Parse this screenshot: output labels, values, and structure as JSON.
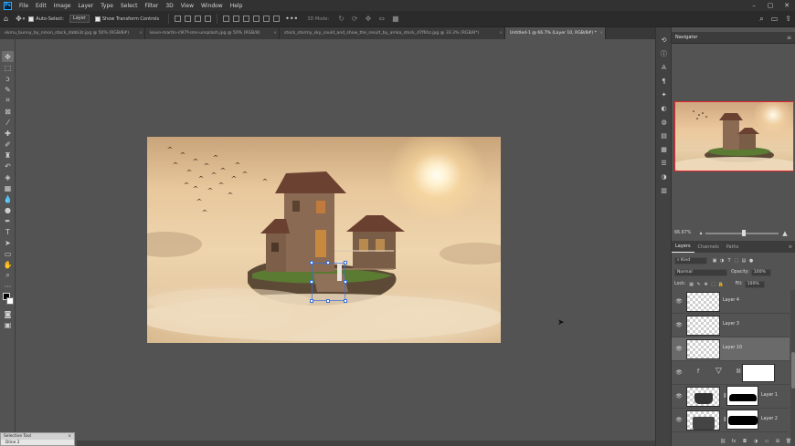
{
  "app": {
    "logo": "Ps"
  },
  "menu": [
    "File",
    "Edit",
    "Image",
    "Layer",
    "Type",
    "Select",
    "Filter",
    "3D",
    "View",
    "Window",
    "Help"
  ],
  "window_controls": [
    "minimize-icon",
    "maximize-icon",
    "close-icon"
  ],
  "options": {
    "auto_select_label": "Auto-Select:",
    "auto_select_value": "Layer",
    "transform_label": "Show Transform Controls",
    "mode_label": "3D Mode:",
    "more": "•••"
  },
  "tabs": [
    {
      "label": "ekmu_bunny_by_nmon_stock_dabb3z.jpg @ 50% (RGB/8#)",
      "active": false
    },
    {
      "label": "kevin-martin-c9l7f-sms-unsplash.jpg @ 50% (RGB/8)",
      "active": false
    },
    {
      "label": "stock_stormy_sky_could_and_show_the_result_by_amka_stock_d7f6hz.jpg @ 33.3% (RGB/8*)",
      "active": false
    },
    {
      "label": "Untitled-1 @ 66.7% (Layer 10, RGB/8#) *",
      "active": true
    }
  ],
  "navigator": {
    "title": "Navigator",
    "zoom": "66.67%"
  },
  "layers_panel": {
    "tabs": [
      "Layers",
      "Channels",
      "Paths"
    ],
    "kind_label": "Kind",
    "blend_mode": "Normal",
    "opacity_label": "Opacity:",
    "opacity_value": "100%",
    "lock_label": "Lock:",
    "fill_label": "Fill:",
    "fill_value": "100%",
    "layers": [
      {
        "name": "Layer 4",
        "selected": false
      },
      {
        "name": "Layer 3",
        "selected": false
      },
      {
        "name": "Layer 10",
        "selected": true
      },
      {
        "name": "",
        "selected": false
      },
      {
        "name": "Layer 1",
        "selected": false
      },
      {
        "name": "Layer 2",
        "selected": false
      }
    ]
  },
  "float_panel": {
    "title": "Selective Tool",
    "subtitle": "Dline 2"
  },
  "colors": {
    "accent": "#31a8ff",
    "selection": "#e0262c",
    "panel_bg": "#535353"
  }
}
